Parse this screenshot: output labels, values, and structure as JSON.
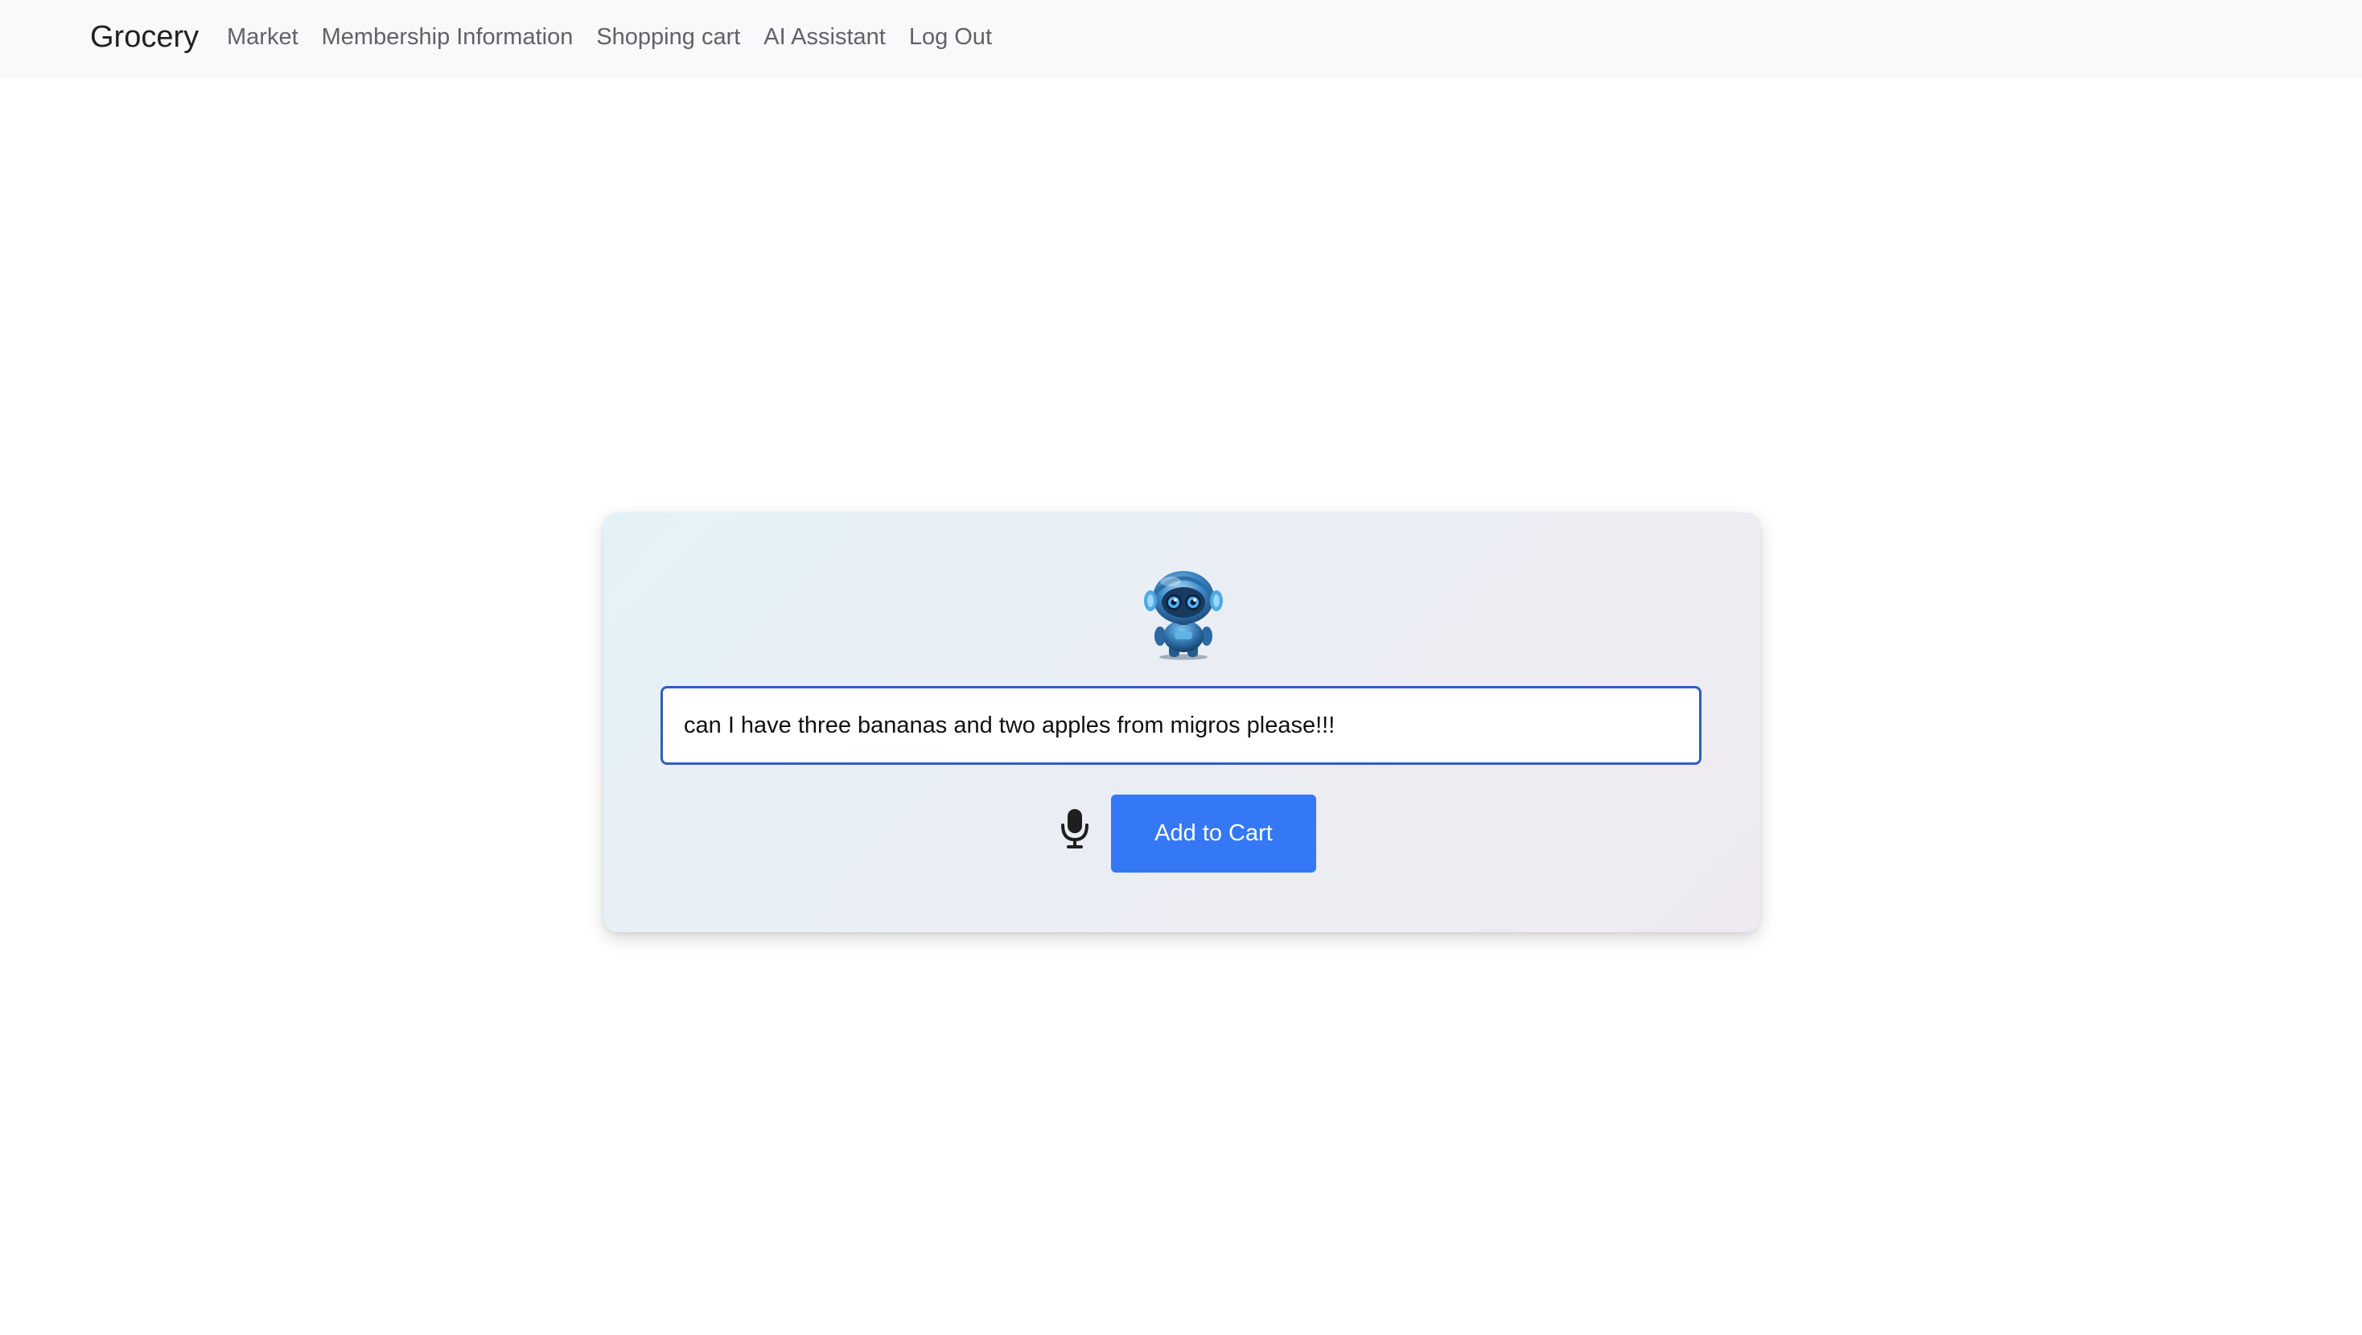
{
  "navbar": {
    "brand": "Grocery",
    "links": [
      {
        "label": "Market"
      },
      {
        "label": "Membership Information"
      },
      {
        "label": "Shopping cart"
      },
      {
        "label": "AI Assistant"
      },
      {
        "label": "Log Out"
      }
    ]
  },
  "assistant": {
    "avatar_icon": "robot-icon",
    "query_value": "can I have three bananas and two apples from migros please!!!",
    "mic_icon": "microphone-icon",
    "submit_label": "Add to Cart"
  },
  "colors": {
    "navbar_bg": "#f8f9fa",
    "button_bg": "#3478f6",
    "input_border": "#2f5fbd"
  }
}
